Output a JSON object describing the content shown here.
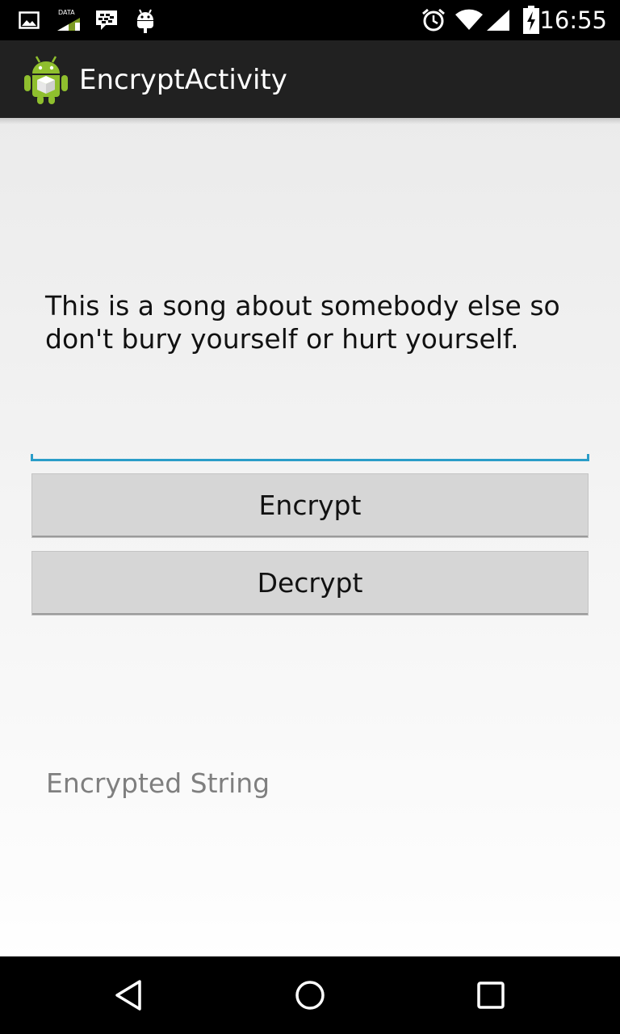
{
  "status_bar": {
    "time": "16:55",
    "data_badge": "DATA",
    "icons": [
      "gallery-icon",
      "data-signal-icon",
      "bbm-icon",
      "android-icon",
      "alarm-icon",
      "wifi-icon",
      "cell-signal-icon",
      "battery-charging-icon"
    ]
  },
  "action_bar": {
    "title": "EncryptActivity",
    "icon": "android-app-icon"
  },
  "main": {
    "message": "This is a song about somebody else so don't bury yourself or hurt yourself.",
    "input_value": "",
    "encrypt_label": "Encrypt",
    "decrypt_label": "Decrypt",
    "result_text": "Encrypted String"
  },
  "nav_bar": {
    "icons": [
      "back-icon",
      "home-icon",
      "recents-icon"
    ]
  },
  "colors": {
    "accent": "#2a9dc8",
    "action_bar": "#212121",
    "button": "#d6d6d6"
  }
}
